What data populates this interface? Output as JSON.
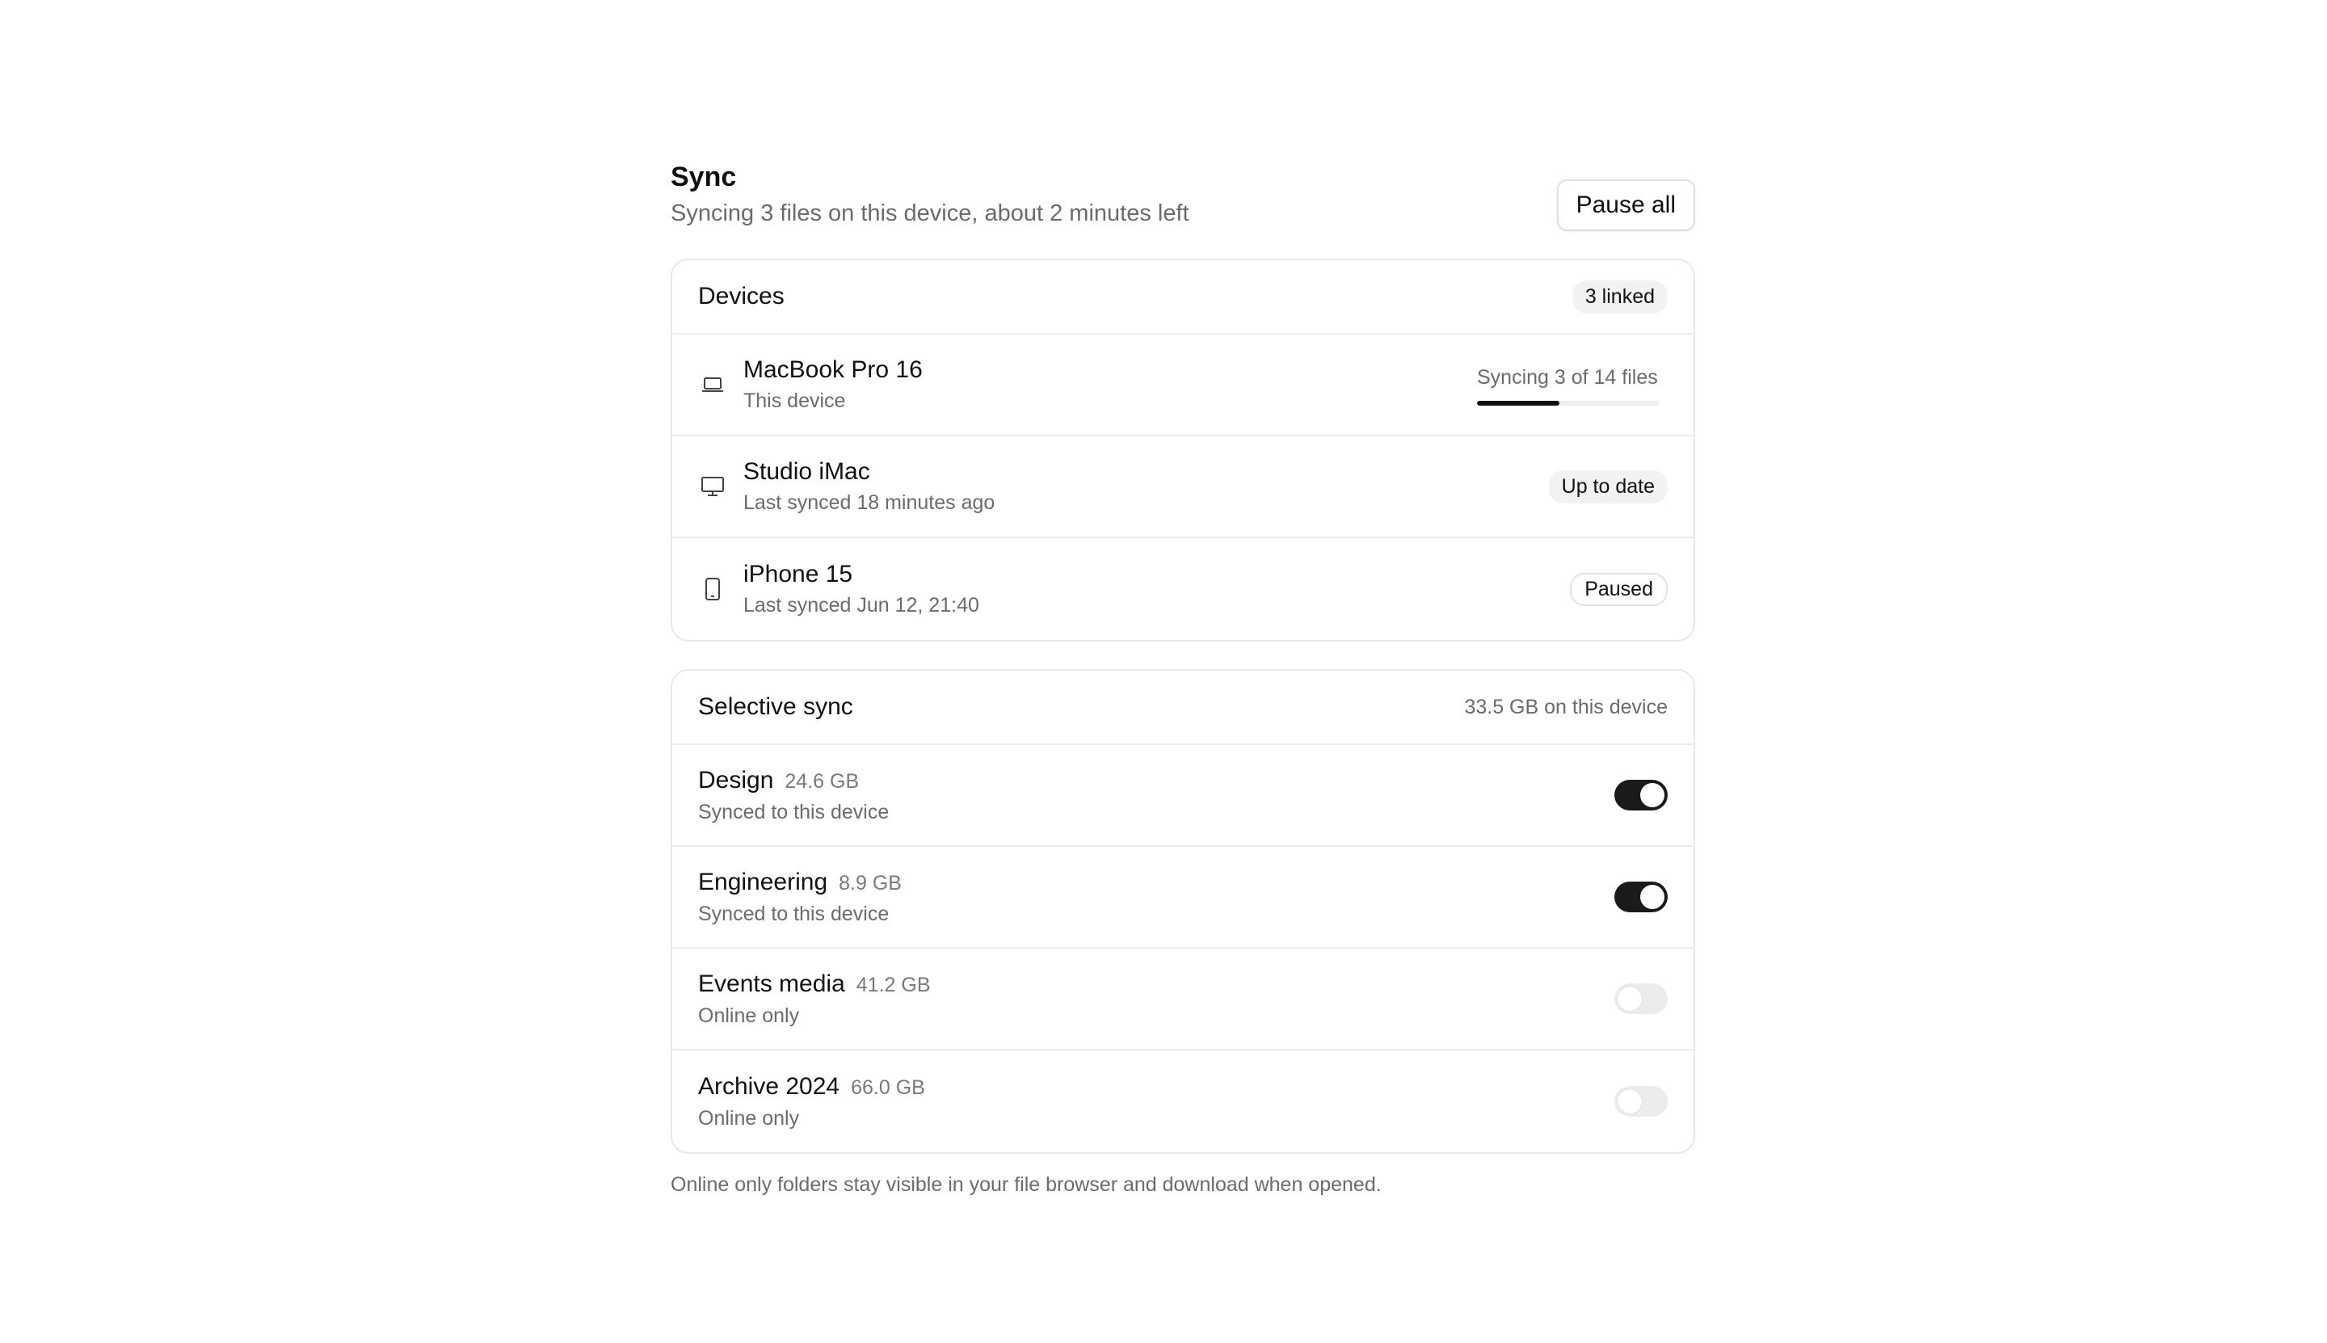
{
  "header": {
    "title": "Sync",
    "subtitle": "Syncing 3 files on this device, about 2 minutes left",
    "pause_label": "Pause all"
  },
  "devices": {
    "title": "Devices",
    "badge": "3 linked",
    "items": [
      {
        "name": "MacBook Pro 16",
        "sub": "This device",
        "icon": "laptop-icon",
        "status": "Syncing 3 of 14 files",
        "progress": 0.45
      },
      {
        "name": "Studio iMac",
        "sub": "Last synced 18 minutes ago",
        "icon": "desktop-icon",
        "status": "Up to date"
      },
      {
        "name": "iPhone 15",
        "sub": "Last synced Jun 12, 21:40",
        "icon": "phone-icon",
        "status": "Paused"
      }
    ]
  },
  "selective": {
    "title": "Selective sync",
    "meta": "33.5 GB on this device",
    "items": [
      {
        "name": "Design",
        "size": "24.6 GB",
        "sub": "Synced to this device",
        "enabled": true
      },
      {
        "name": "Engineering",
        "size": "8.9 GB",
        "sub": "Synced to this device",
        "enabled": true
      },
      {
        "name": "Events media",
        "size": "41.2 GB",
        "sub": "Online only",
        "enabled": false
      },
      {
        "name": "Archive 2024",
        "size": "66.0 GB",
        "sub": "Online only",
        "enabled": false
      }
    ]
  },
  "footnote": "Online only folders stay visible in your file browser and download when opened.",
  "colors": {
    "accent": "#111111",
    "muted_text": "#6b6b6b",
    "border": "#e8e8e8",
    "toggle_on": "#1a1a1a",
    "toggle_off": "#ececec"
  }
}
